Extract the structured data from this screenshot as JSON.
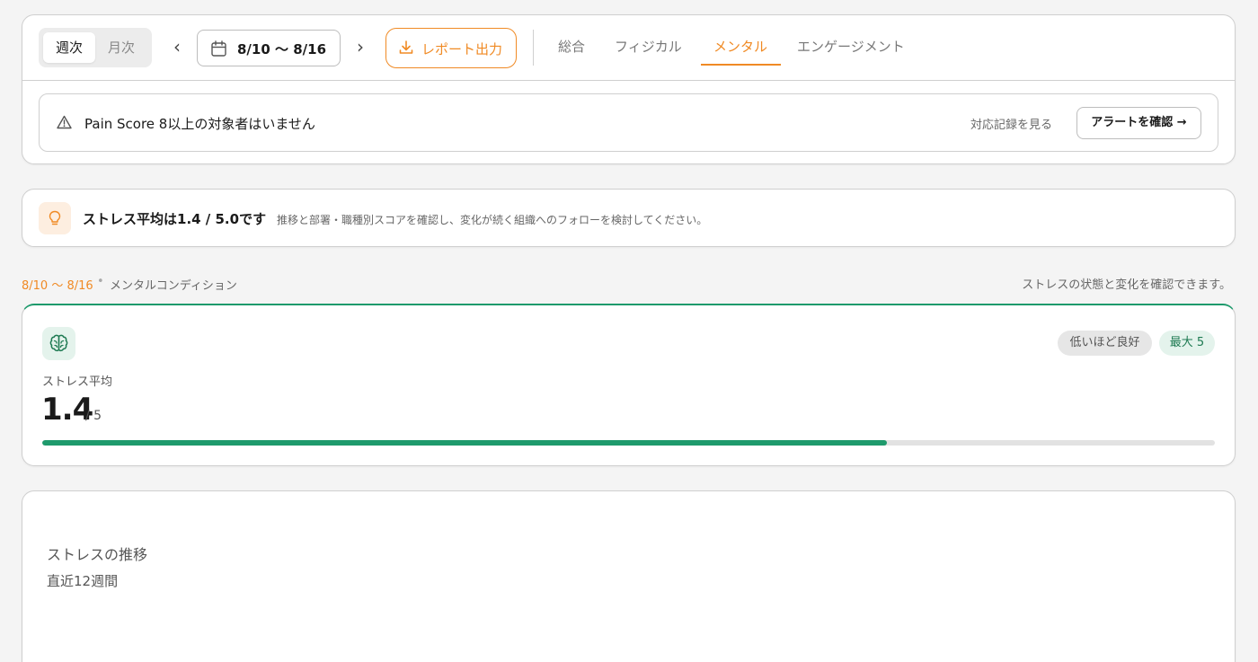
{
  "toolbar": {
    "period_weekly": "週次",
    "period_monthly": "月次",
    "date_range": "8/10 〜 8/16",
    "report_label": "レポート出力",
    "tabs": [
      {
        "label": "総合"
      },
      {
        "label": "フィジカル"
      },
      {
        "label": "メンタル"
      },
      {
        "label": "エンゲージメント"
      }
    ],
    "active_tab": "メンタル",
    "accent_color": "#f08a24"
  },
  "alert": {
    "message": "Pain Score 8以上の対象者はいません",
    "link": "対応記録を見る",
    "button": "アラートを確認 →"
  },
  "insight": {
    "title": "ストレス平均は1.4 / 5.0です",
    "description": "推移と部署・職種別スコアを確認し、変化が続く組織へのフォローを検討してください。"
  },
  "section": {
    "date": "8/10 〜 8/16",
    "label": "メンタルコンディション",
    "note": "ストレスの状態と変化を確認できます。"
  },
  "stress": {
    "label": "ストレス平均",
    "value": "1.4",
    "max_text": "/ 5",
    "badge_hint": "低いほど良好",
    "badge_max": "最大 5",
    "progress_fraction": 0.72,
    "accent_color": "#1e9a6c"
  },
  "trend": {
    "title": "ストレスの推移",
    "subtitle": "直近12週間"
  }
}
